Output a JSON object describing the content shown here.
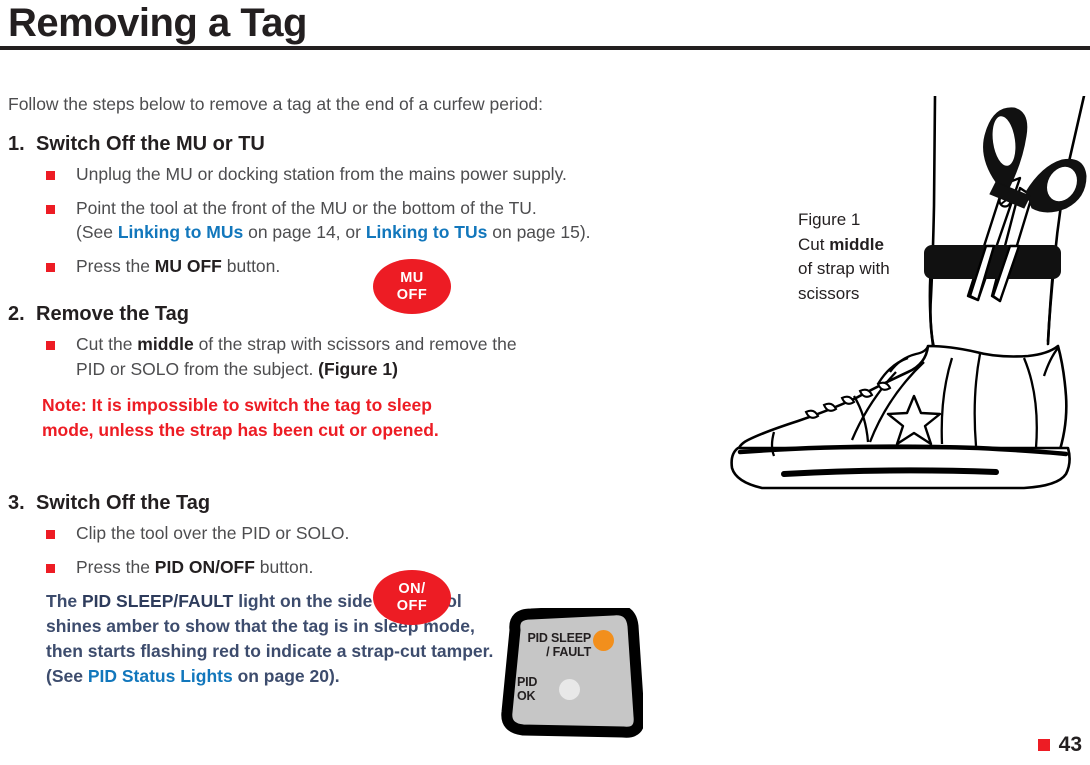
{
  "header": {
    "title": "Removing a Tag"
  },
  "intro": "Follow the steps below to remove a tag at the end of a curfew period:",
  "steps": [
    {
      "number": "1.",
      "heading": "Switch Off the MU or TU",
      "bullets": [
        "Unplug the MU or docking station from the mains power supply.",
        "Point the tool at the front of the MU or the bottom of the TU. (See Linking to MUs on page 14, or Linking to TUs on page 15).",
        "Press the MU OFF button."
      ]
    },
    {
      "number": "2.",
      "heading": "Remove the Tag",
      "bullets": [
        "Cut the middle of the strap with scissors and remove the PID or SOLO from the subject. (Figure 1)"
      ]
    },
    {
      "number": "3.",
      "heading": "Switch Off the Tag",
      "bullets": [
        "Clip the tool over the PID or SOLO.",
        "Press the PID ON/OFF button."
      ]
    }
  ],
  "step1_bullet2": {
    "text_a": "Point the tool at the front of the MU or the bottom of the TU.",
    "text_b": "(See ",
    "link_1": "Linking to MUs",
    "text_c": " on page 14, or ",
    "link_2": "Linking to TUs",
    "text_d": " on page 15)."
  },
  "step1_bullet3": {
    "text_a": "Press the ",
    "bold": "MU OFF",
    "text_b": " button."
  },
  "step2_bullet1": {
    "text_a": "Cut the ",
    "bold_1": "middle",
    "text_b": " of the strap with scissors and remove the PID or SOLO from the subject. ",
    "bold_2": "(Figure 1)"
  },
  "step3_bullet2": {
    "text_a": "Press the ",
    "bold": "PID ON/OFF",
    "text_b": " button."
  },
  "note": {
    "icon": "exclamation-icon",
    "line1": "Note: It is impossible to switch the tag to sleep",
    "line2": "mode, unless the strap has been cut or opened."
  },
  "step3_paragraph": {
    "text_a": "The ",
    "bold_1": "PID SLEEP/FAULT",
    "text_b": " light on the side of the tool shines amber to show that the tag is in sleep mode, then starts flashing red to indicate a strap-cut tamper. (See ",
    "link_1": "PID Status Lights",
    "text_c": " on page 20)."
  },
  "buttons": {
    "mu_off": {
      "line1": "MU",
      "line2": "OFF"
    },
    "on_off": {
      "line1": "ON/",
      "line2": "OFF"
    }
  },
  "pid_tool": {
    "sleep_fault_line1": "PID SLEEP",
    "sleep_fault_line2": "/ FAULT",
    "ok_line1": "PID",
    "ok_line2": "OK",
    "led_amber_color": "#f28f1c",
    "led_grey_color": "#e8e8e8",
    "body_color": "#c6c6c6"
  },
  "figure": {
    "caption_line1": "Figure 1",
    "caption_line2_a": "Cut ",
    "caption_line2_b": "middle",
    "caption_line3": "of strap with",
    "caption_line4": "scissors"
  },
  "footer": {
    "page_number": "43"
  },
  "colors": {
    "accent_red": "#ed1c24",
    "link_blue": "#1277bc",
    "slate_blue": "#3d4c6d",
    "body_grey": "#4d4d4f",
    "ink": "#231f20"
  }
}
